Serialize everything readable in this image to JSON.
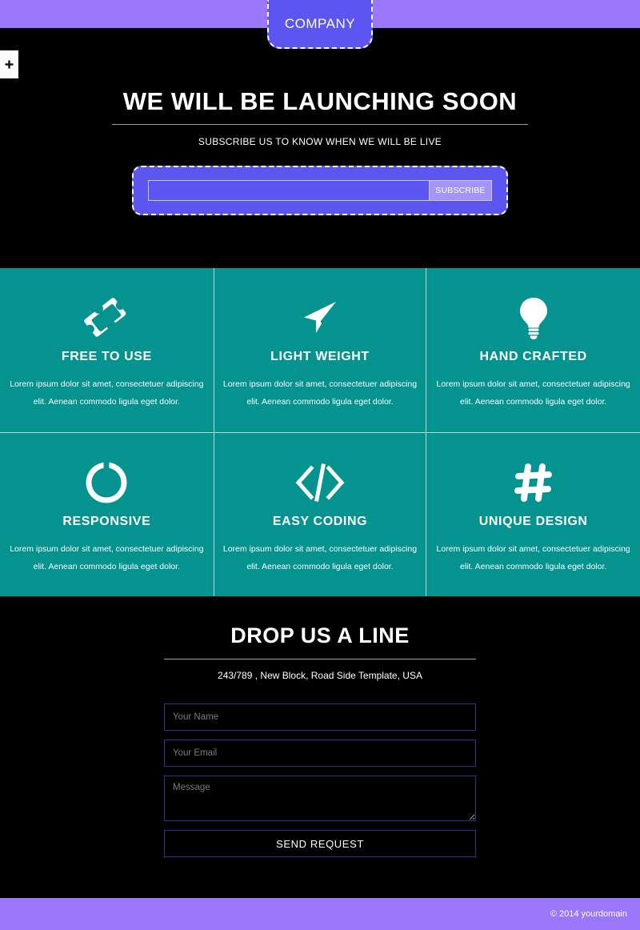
{
  "colors": {
    "header_purple": "#9a77fb",
    "logo_purple": "#5d55ef",
    "teal": "#05938f",
    "black": "#000000",
    "field_border": "#372f8e",
    "subscribe_button": "#a495fb"
  },
  "header": {
    "logo_label": "COMPANY",
    "toggle_icon": "plus-icon"
  },
  "hero": {
    "title": "WE WILL BE LAUNCHING SOON",
    "subtitle": "SUBSCRIBE US TO KNOW WHEN WE WILL BE LIVE",
    "email_placeholder": "",
    "email_value": "",
    "subscribe_label": "SUBSCRIBE"
  },
  "features": [
    {
      "icon": "ticket-icon",
      "title": "FREE TO USE",
      "desc": "Lorem ipsum dolor sit amet, consectetuer adipiscing elit. Aenean commodo ligula eget dolor."
    },
    {
      "icon": "paper-plane-icon",
      "title": "LIGHT WEIGHT",
      "desc": "Lorem ipsum dolor sit amet, consectetuer adipiscing elit. Aenean commodo ligula eget dolor."
    },
    {
      "icon": "lightbulb-icon",
      "title": "HAND CRAFTED",
      "desc": "Lorem ipsum dolor sit amet, consectetuer adipiscing elit. Aenean commodo ligula eget dolor."
    },
    {
      "icon": "circle-ring-icon",
      "title": "RESPONSIVE",
      "desc": "Lorem ipsum dolor sit amet, consectetuer adipiscing elit. Aenean commodo ligula eget dolor."
    },
    {
      "icon": "code-brackets-icon",
      "title": "EASY CODING",
      "desc": "Lorem ipsum dolor sit amet, consectetuer adipiscing elit. Aenean commodo ligula eget dolor."
    },
    {
      "icon": "hashtag-icon",
      "title": "UNIQUE DESIGN",
      "desc": "Lorem ipsum dolor sit amet, consectetuer adipiscing elit. Aenean commodo ligula eget dolor."
    }
  ],
  "contact": {
    "title": "DROP US A LINE",
    "address": "243/789 , New Block, Road Side Template, USA",
    "name_placeholder": "Your Name",
    "name_value": "",
    "email_placeholder": "Your Email",
    "email_value": "",
    "message_placeholder": "Message",
    "message_value": "",
    "submit_label": "SEND REQUEST"
  },
  "footer": {
    "copyright": "© 2014 yourdomain"
  }
}
